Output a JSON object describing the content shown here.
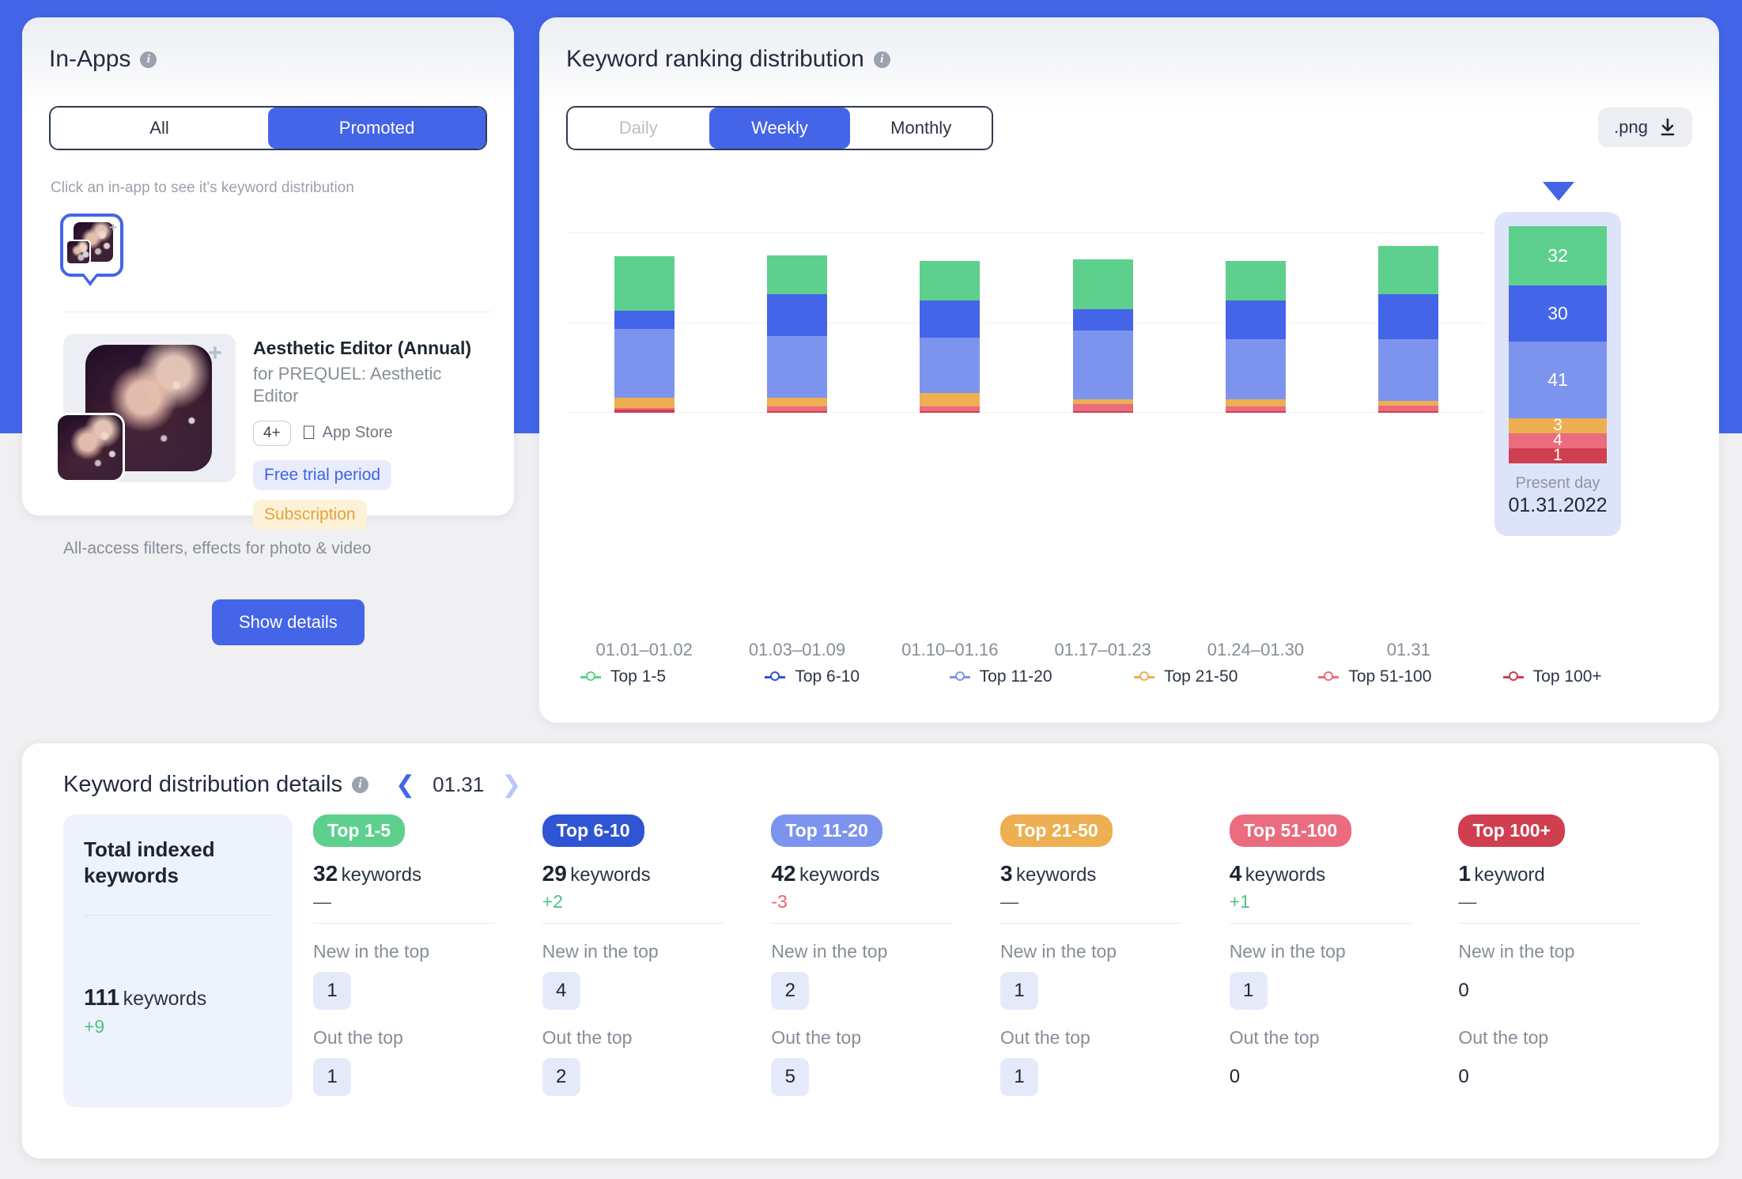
{
  "theme": {
    "accent": "#4465E8",
    "page_bg": "#f0f0f2"
  },
  "inapps": {
    "title": "In-Apps",
    "info_icon": "info-icon",
    "tabs": [
      {
        "label": "All",
        "active": false
      },
      {
        "label": "Promoted",
        "active": true
      }
    ],
    "hint": "Click an in-app to see it's keyword distribution",
    "app": {
      "name": "Aesthetic Editor (Annual)",
      "subtitle": "for PREQUEL: Aesthetic Editor",
      "age_rating": "4+",
      "store": "App Store",
      "store_icon": "apple-icon",
      "tags": [
        {
          "label": "Free trial period",
          "kind": "trial"
        },
        {
          "label": "Subscription",
          "kind": "subscription"
        }
      ],
      "description": "All-access filters, effects for photo & video"
    },
    "show_details_label": "Show details"
  },
  "chart_panel": {
    "title": "Keyword ranking distribution",
    "info_icon": "info-icon",
    "granularity": [
      {
        "label": "Daily",
        "active": false,
        "disabled": true
      },
      {
        "label": "Weekly",
        "active": true,
        "disabled": false
      },
      {
        "label": "Monthly",
        "active": false,
        "disabled": false
      }
    ],
    "export": {
      "label": ".png",
      "icon": "download-icon"
    },
    "present": {
      "caption": "Present day",
      "date": "01.31.2022",
      "segments": [
        {
          "name": "Top 1-5",
          "value": 32,
          "color": "#5DD08D"
        },
        {
          "name": "Top 6-10",
          "value": 30,
          "color": "#4465E8"
        },
        {
          "name": "Top 11-20",
          "value": 41,
          "color": "#7C94EE"
        },
        {
          "name": "Top 21-50",
          "value": 3,
          "color": "#EDAF52"
        },
        {
          "name": "Top 51-100",
          "value": 4,
          "color": "#EB6B7F"
        },
        {
          "name": "Top 100+",
          "value": 1,
          "color": "#CF3F4F"
        }
      ]
    }
  },
  "chart_data": {
    "type": "bar",
    "stacked": true,
    "title": "Keyword ranking distribution",
    "xlabel": "",
    "ylabel": "",
    "grid": true,
    "legend_position": "bottom",
    "ylim": [
      0,
      120
    ],
    "categories": [
      "01.01–01.02",
      "01.03–01.09",
      "01.10–01.16",
      "01.17–01.23",
      "01.24–01.30",
      "01.31"
    ],
    "series": [
      {
        "name": "Top 1-5",
        "color": "#5DD08D",
        "values": [
          36,
          26,
          26,
          33,
          26,
          32
        ]
      },
      {
        "name": "Top 6-10",
        "color": "#4465E8",
        "values": [
          12,
          28,
          25,
          14,
          26,
          30
        ]
      },
      {
        "name": "Top 11-20",
        "color": "#7C94EE",
        "values": [
          46,
          41,
          37,
          46,
          40,
          41
        ]
      },
      {
        "name": "Top 21-50",
        "color": "#EDAF52",
        "values": [
          7,
          6,
          9,
          3,
          5,
          3
        ]
      },
      {
        "name": "Top 51-100",
        "color": "#EB6B7F",
        "values": [
          1,
          3,
          3,
          5,
          3,
          4
        ]
      },
      {
        "name": "Top 100+",
        "color": "#CF3F4F",
        "values": [
          2,
          1,
          1,
          1,
          1,
          1
        ]
      }
    ],
    "legend": [
      {
        "label": "Top 1-5",
        "color": "#5DD08D"
      },
      {
        "label": "Top 6-10",
        "color": "#2F55D4"
      },
      {
        "label": "Top 11-20",
        "color": "#7C94EE"
      },
      {
        "label": "Top 21-50",
        "color": "#EDAF52"
      },
      {
        "label": "Top 51-100",
        "color": "#EB6B7F"
      },
      {
        "label": "Top 100+",
        "color": "#CF3F4F"
      }
    ]
  },
  "details": {
    "title": "Keyword distribution details",
    "info_icon": "info-icon",
    "prev_icon": "chevron-left-icon",
    "next_icon": "chevron-right-icon",
    "date": "01.31",
    "total": {
      "title": "Total indexed keywords",
      "count": "111",
      "unit": "keywords",
      "delta": "+9"
    },
    "labels": {
      "keywords_unit": "keywords",
      "new_in_top": "New in the top",
      "out_the_top": "Out the top"
    },
    "columns": [
      {
        "pill": "Top 1-5",
        "color": "#5DD08D",
        "count": "32",
        "delta": "—",
        "delta_kind": "none",
        "new_in_top": "1",
        "out_the_top": "1",
        "unit": "keywords"
      },
      {
        "pill": "Top 6-10",
        "color": "#2F55D4",
        "count": "29",
        "delta": "+2",
        "delta_kind": "pos",
        "new_in_top": "4",
        "out_the_top": "2",
        "unit": "keywords"
      },
      {
        "pill": "Top 11-20",
        "color": "#7C94EE",
        "count": "42",
        "delta": "-3",
        "delta_kind": "neg",
        "new_in_top": "2",
        "out_the_top": "5",
        "unit": "keywords"
      },
      {
        "pill": "Top 21-50",
        "color": "#EDAF52",
        "count": "3",
        "delta": "—",
        "delta_kind": "none",
        "new_in_top": "1",
        "out_the_top": "1",
        "unit": "keywords"
      },
      {
        "pill": "Top 51-100",
        "color": "#EB6B7F",
        "count": "4",
        "delta": "+1",
        "delta_kind": "pos",
        "new_in_top": "1",
        "out_the_top": "0",
        "unit": "keywords"
      },
      {
        "pill": "Top 100+",
        "color": "#CF3F4F",
        "count": "1",
        "delta": "—",
        "delta_kind": "none",
        "new_in_top": "0",
        "out_the_top": "0",
        "unit": "keyword"
      }
    ]
  }
}
